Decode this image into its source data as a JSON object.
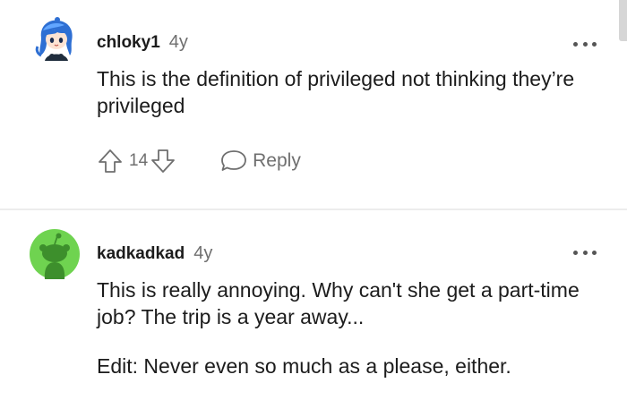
{
  "comments": [
    {
      "username": "chloky1",
      "age": "4y",
      "paragraphs": [
        "This is the definition of privileged not thinking they’re privileged"
      ],
      "score": "14",
      "reply_label": "Reply",
      "avatar_icon": "anime-girl-avatar-icon",
      "avatar_color": "#2e6fd3"
    },
    {
      "username": "kadkadkad",
      "age": "4y",
      "paragraphs": [
        "This is really annoying. Why can't she get a part-time job? The trip is a year away...",
        "Edit: Never even so much as a please, either."
      ],
      "avatar_icon": "snoo-avatar-icon",
      "avatar_color": "#6fd350"
    }
  ],
  "colors": {
    "text": "#1c1c1c",
    "meta": "#6f6f6f",
    "divider": "#ececec"
  }
}
